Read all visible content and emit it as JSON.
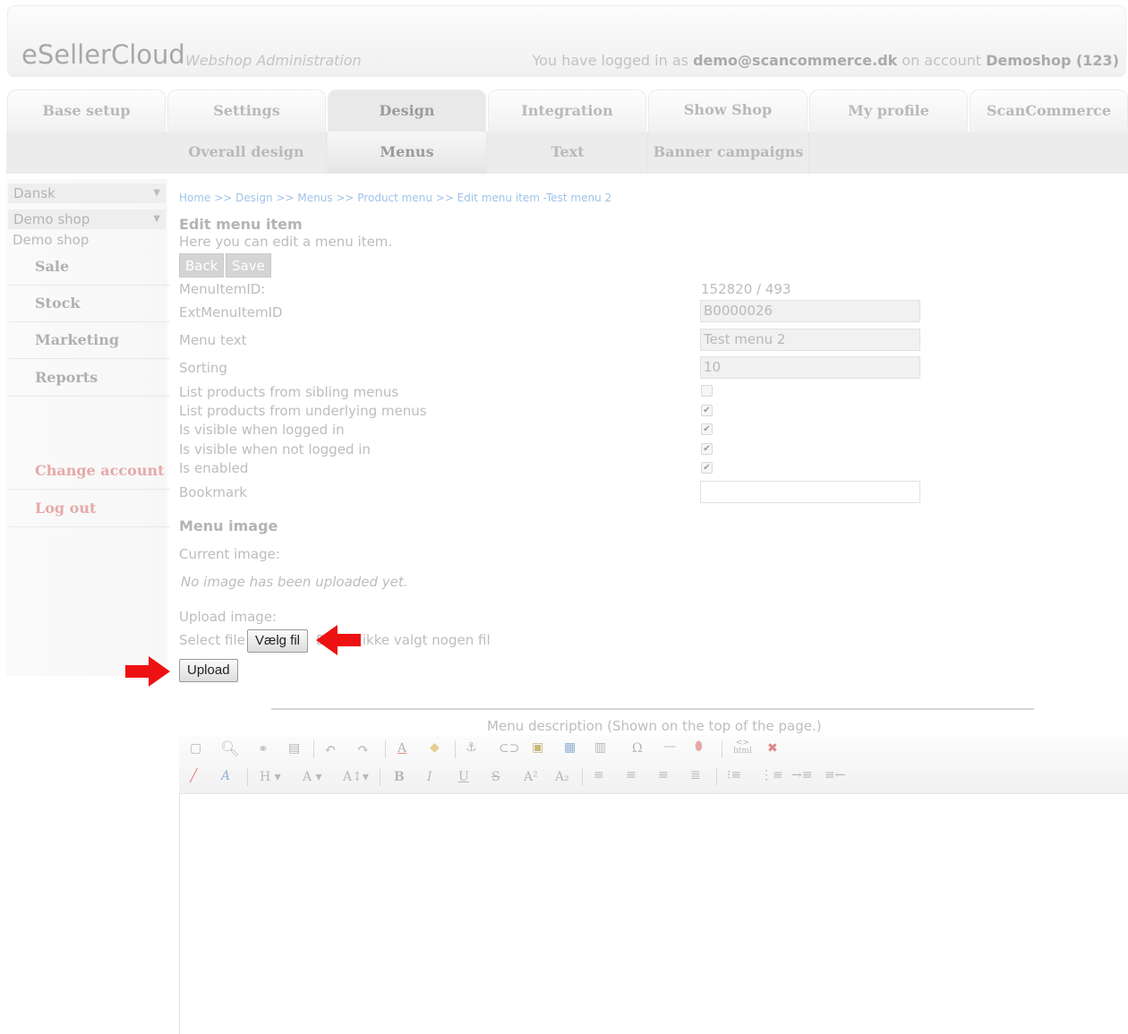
{
  "header": {
    "logo": "eSellerCloud",
    "subtitle": "Webshop Administration",
    "login_prefix": "You have logged in as ",
    "login_user": "demo@scancommerce.dk",
    "login_mid": " on account ",
    "login_account": "Demoshop (123)"
  },
  "tabs": [
    "Base setup",
    "Settings",
    "Design",
    "Integration",
    "Show Shop",
    "My profile",
    "ScanCommerce"
  ],
  "active_tab": "Design",
  "subtabs": [
    "Overall design",
    "Menus",
    "Text",
    "Banner campaigns"
  ],
  "active_subtab": "Menus",
  "sidebar": {
    "language": "Dansk",
    "shop_select": "Demo shop",
    "shop_label": "Demo shop",
    "items": [
      "Sale",
      "Stock",
      "Marketing",
      "Reports"
    ],
    "account_items": [
      "Change account",
      "Log out"
    ]
  },
  "breadcrumb": "Home >> Design >> Menus >> Product menu >> Edit menu item -Test menu 2",
  "page": {
    "title": "Edit menu item",
    "description": "Here you can edit a menu item.",
    "back_label": "Back",
    "save_label": "Save"
  },
  "form": {
    "menuitemid_label": "MenuItemID:",
    "menuitemid_value": "152820 / 493",
    "extid_label": "ExtMenuItemID",
    "extid_value": "B0000026",
    "menutext_label": "Menu text",
    "menutext_value": "Test menu 2",
    "sorting_label": "Sorting",
    "sorting_value": "10",
    "checkboxes": [
      {
        "label": "List products from sibling menus",
        "checked": false
      },
      {
        "label": "List products from underlying menus",
        "checked": true
      },
      {
        "label": "Is visible when logged in",
        "checked": true
      },
      {
        "label": "Is visible when not logged in",
        "checked": true
      },
      {
        "label": "Is enabled",
        "checked": true
      }
    ],
    "bookmark_label": "Bookmark",
    "bookmark_value": ""
  },
  "menu_image": {
    "heading": "Menu image",
    "current_label": "Current image:",
    "no_image": "No image has been uploaded yet.",
    "upload_label": "Upload image:",
    "select_file": "Select file",
    "choose_button": "Vælg fil",
    "no_file": "Der er ikke valgt nogen fil",
    "upload_button": "Upload"
  },
  "editor": {
    "caption": "Menu description (Shown on the top of the page.)",
    "html_label": "html"
  },
  "colors": {
    "arrow": "#ee1111",
    "link": "#9fc3e8"
  }
}
